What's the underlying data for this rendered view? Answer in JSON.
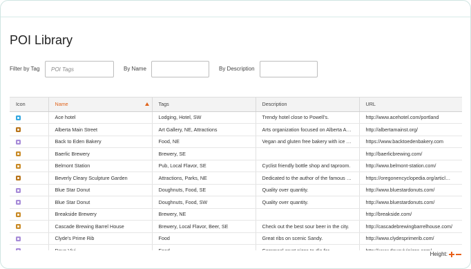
{
  "page": {
    "title": "POI Library"
  },
  "filters": {
    "tag_label": "Filter by Tag",
    "tag_placeholder": "POI Tags",
    "tag_value": "",
    "name_label": "By Name",
    "name_value": "",
    "description_label": "By Description",
    "description_value": ""
  },
  "table": {
    "columns": [
      "Icon",
      "Name",
      "Tags",
      "Description",
      "URL"
    ],
    "sorted_column": "Name",
    "sort_direction": "ascending",
    "rows": [
      {
        "icon": "hotel-icon",
        "name": "Ace hotel",
        "tags": "Lodging, Hotel, SW",
        "description": "Trendy hotel close to Powell's.",
        "url": "http://www.acehotel.com/portland"
      },
      {
        "icon": "attraction-icon",
        "name": "Alberta Main Street",
        "tags": "Art Gallery, NE, Attractions",
        "description": "Arts organization focused on Alberta A…",
        "url": "http://albertamainst.org/"
      },
      {
        "icon": "food-icon",
        "name": "Back to Eden Bakery",
        "tags": "Food, NE",
        "description": "Vegan and gluten free bakery with ice …",
        "url": "https://www.backtoedenbakery.com"
      },
      {
        "icon": "brewery-icon",
        "name": "Baerlic Brewery",
        "tags": "Brewery, SE",
        "description": "",
        "url": "http://baerlicbrewing.com/"
      },
      {
        "icon": "brewery-icon",
        "name": "Belmont Station",
        "tags": "Pub, Local Flavor, SE",
        "description": "Cyclist friendly bottle shop and taproom.",
        "url": "http://www.belmont-station.com/"
      },
      {
        "icon": "attraction-icon",
        "name": "Beverly Cleary Sculpture Garden",
        "tags": "Attractions, Parks, NE",
        "description": "Dedicated to the author of the famous …",
        "url": "https://oregonencyclopedia.org/articl…"
      },
      {
        "icon": "food-icon",
        "name": "Blue Star Donut",
        "tags": "Doughnuts, Food, SE",
        "description": "Quality over quantity.",
        "url": "http://www.bluestardonuts.com/"
      },
      {
        "icon": "food-icon",
        "name": "Blue Star Donut",
        "tags": "Doughnuts, Food, SW",
        "description": "Quality over quantity.",
        "url": "http://www.bluestardonuts.com/"
      },
      {
        "icon": "brewery-icon",
        "name": "Breakside Brewery",
        "tags": "Brewery, NE",
        "description": "",
        "url": "http://breakside.com/"
      },
      {
        "icon": "brewery-icon",
        "name": "Cascade Brewing Barrel House",
        "tags": "Brewery, Local Flavor, Beer, SE",
        "description": "Check out the best sour beer in the city.",
        "url": "http://cascadebrewingbarrelhouse.com/"
      },
      {
        "icon": "food-icon",
        "name": "Clyde's Prime Rib",
        "tags": "Food",
        "description": "Great ribs on scenic Sandy.",
        "url": "http://www.clydesprimerib.com/"
      },
      {
        "icon": "food-icon",
        "name": "Dove Vivi",
        "tags": "Food",
        "description": "Cornmeal crust pizza to die for.",
        "url": "http://www.dovevivipizza.com/"
      }
    ]
  },
  "height_control": {
    "label": "Height:"
  },
  "colors": {
    "accent": "#e8601a",
    "hotel": "#33a7e0",
    "attraction": "#b8741a",
    "food": "#a78bd8",
    "brewery": "#c98a26"
  }
}
